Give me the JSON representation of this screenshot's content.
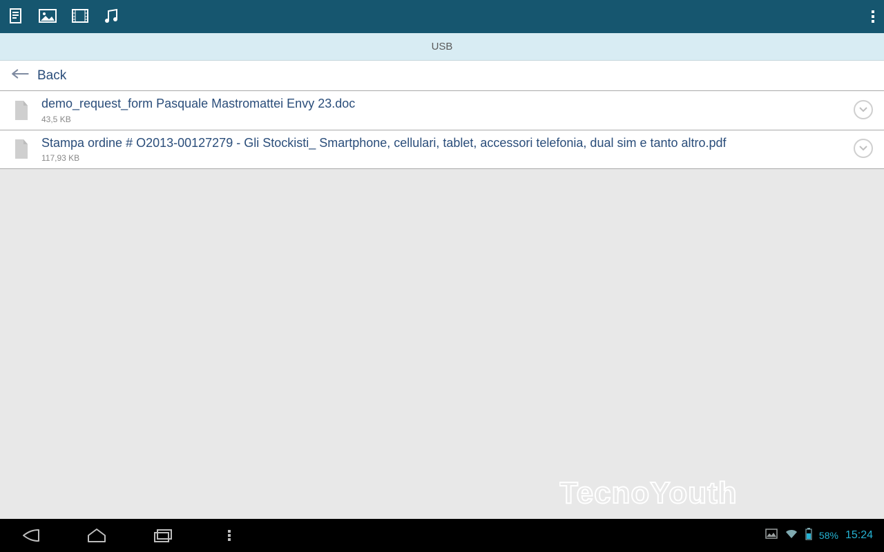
{
  "location": {
    "label": "USB"
  },
  "back": {
    "label": "Back"
  },
  "files": [
    {
      "name": "demo_request_form Pasquale Mastromattei Envy 23.doc",
      "size": "43,5 KB"
    },
    {
      "name": "Stampa ordine # O2013-00127279 - Gli Stockisti_ Smartphone, cellulari, tablet, accessori telefonia, dual sim e tanto altro.pdf",
      "size": "117,93 KB"
    }
  ],
  "status": {
    "battery": "58%",
    "time": "15:24"
  },
  "watermark": "TecnoYouth",
  "colors": {
    "topbar": "#16566f",
    "location": "#d8ecf3",
    "link": "#2a4d7a",
    "accent": "#25b3d4"
  }
}
